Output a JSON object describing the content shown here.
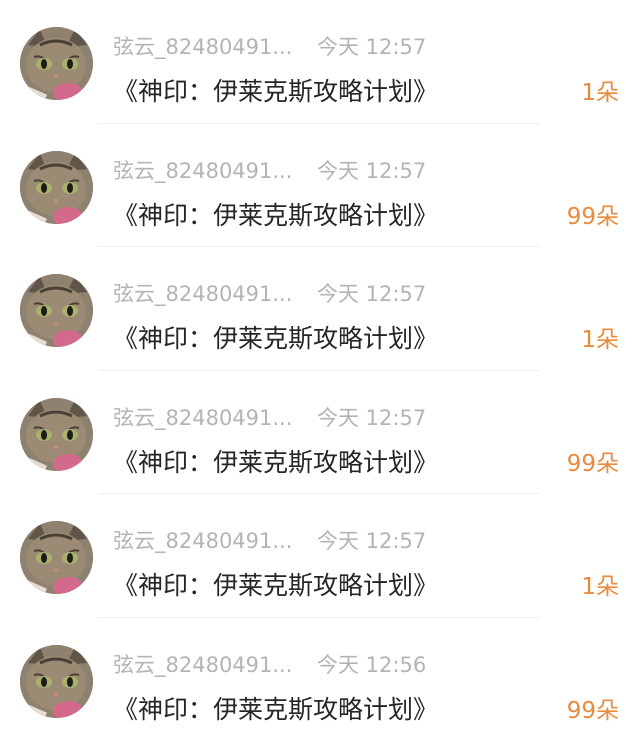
{
  "colors": {
    "name_time": "#b4b4b4",
    "gift_title": "#262626",
    "count": "#e98a3c",
    "divider": "#efefef"
  },
  "items": [
    {
      "avatar_icon": "cat-avatar-icon",
      "username": "弦云_82480491...",
      "time": "今天 12:57",
      "gift": "《神印：伊莱克斯攻略计划》",
      "count": "1朵"
    },
    {
      "avatar_icon": "cat-avatar-icon",
      "username": "弦云_82480491...",
      "time": "今天 12:57",
      "gift": "《神印：伊莱克斯攻略计划》",
      "count": "99朵"
    },
    {
      "avatar_icon": "cat-avatar-icon",
      "username": "弦云_82480491...",
      "time": "今天 12:57",
      "gift": "《神印：伊莱克斯攻略计划》",
      "count": "1朵"
    },
    {
      "avatar_icon": "cat-avatar-icon",
      "username": "弦云_82480491...",
      "time": "今天 12:57",
      "gift": "《神印：伊莱克斯攻略计划》",
      "count": "99朵"
    },
    {
      "avatar_icon": "cat-avatar-icon",
      "username": "弦云_82480491...",
      "time": "今天 12:57",
      "gift": "《神印：伊莱克斯攻略计划》",
      "count": "1朵"
    },
    {
      "avatar_icon": "cat-avatar-icon",
      "username": "弦云_82480491...",
      "time": "今天 12:56",
      "gift": "《神印：伊莱克斯攻略计划》",
      "count": "99朵"
    }
  ]
}
